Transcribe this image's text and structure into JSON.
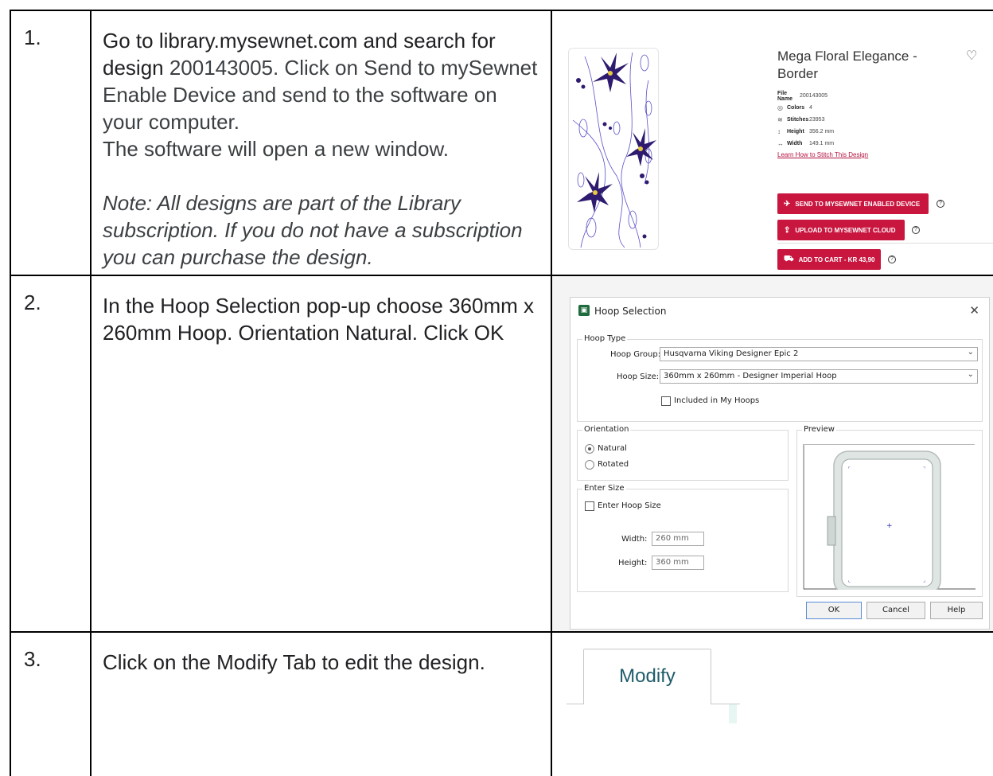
{
  "steps": [
    {
      "num": "1.",
      "text_a": "Go to library.mysewnet.com and search for design ",
      "text_code": "200143005",
      "text_b": ".  Click on Send to mySewnet Enable Device and send to the software on your computer.",
      "text_c": "The software will open a new window.",
      "note": "Note: All designs are part of the Library subscription. If you do not have a subscription you can purchase the design."
    },
    {
      "num": "2.",
      "text": "In the Hoop Selection pop-up choose 360mm x 260mm Hoop. Orientation Natural. Click OK"
    },
    {
      "num": "3.",
      "text": "Click on the Modify Tab to edit the design."
    }
  ],
  "product": {
    "title": "Mega Floral Elegance - Border",
    "specs": [
      {
        "icon": "file-icon",
        "label": "File Name",
        "value": "200143005"
      },
      {
        "icon": "palette-icon",
        "label": "Colors",
        "value": "4"
      },
      {
        "icon": "stitches-icon",
        "label": "Stitches",
        "value": "23953"
      },
      {
        "icon": "height-icon",
        "label": "Height",
        "value": "356.2 mm"
      },
      {
        "icon": "width-icon",
        "label": "Width",
        "value": "149.1 mm"
      }
    ],
    "learn_link": "Learn How to Stitch This Design",
    "send_button": "SEND TO MYSEWNET ENABLED DEVICE",
    "upload_button": "UPLOAD TO MYSEWNET CLOUD",
    "cart_button": "ADD TO CART - KR 43,90",
    "accent_color": "#c8163f"
  },
  "dialog": {
    "title": "Hoop Selection",
    "hoop_type_label": "Hoop Type",
    "hoop_group_label": "Hoop Group:",
    "hoop_group_value": "Husqvarna Viking Designer Epic 2",
    "hoop_size_label": "Hoop Size:",
    "hoop_size_value": "360mm x 260mm - Designer Imperial Hoop",
    "included_label": "Included in My Hoops",
    "orientation_label": "Orientation",
    "natural_label": "Natural",
    "rotated_label": "Rotated",
    "preview_label": "Preview",
    "enter_size_label": "Enter Size",
    "enter_hoop_size_label": "Enter Hoop Size",
    "width_label": "Width:",
    "width_value": "260 mm",
    "height_label": "Height:",
    "height_value": "360 mm",
    "ok_label": "OK",
    "cancel_label": "Cancel",
    "help_label": "Help"
  },
  "tab": {
    "label": "Modify"
  }
}
